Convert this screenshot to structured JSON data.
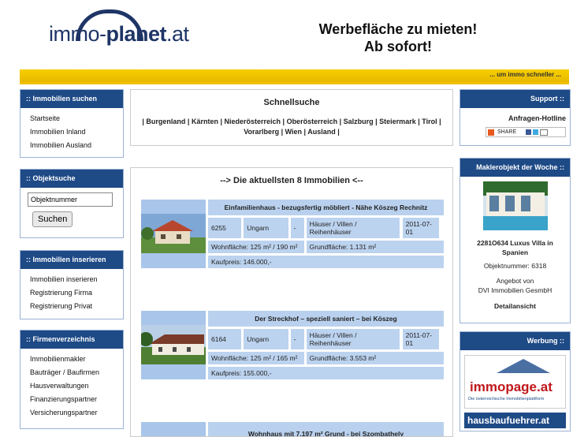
{
  "header": {
    "logo_prefix": "immo-",
    "logo_main": "planet",
    "logo_suffix": ".at",
    "ad_line1": "Werbefläche zu mieten!",
    "ad_line2": "Ab sofort!",
    "slogan": "... um immo schneller ..."
  },
  "left": {
    "search": {
      "head": ":: Immobilien suchen",
      "items": [
        "Startseite",
        "Immobilien Inland",
        "Immobilien Ausland"
      ]
    },
    "objekt": {
      "head": ":: Objektsuche",
      "placeholder": "Objektnummer",
      "button": "Suchen"
    },
    "inserieren": {
      "head": ":: Immobilien inserieren",
      "items": [
        "Immobilien inserieren",
        "Registrierung Firma",
        "Registrierung Privat"
      ]
    },
    "firmen": {
      "head": ":: Firmenverzeichnis",
      "items": [
        "Immobilienmakler",
        "Bauträger / Baufirmen",
        "Hausverwaltungen",
        "Finanzierungspartner",
        "Versicherungspartner"
      ]
    }
  },
  "center": {
    "schnell_title": "Schnellsuche",
    "regions": [
      "Burgenland",
      "Kärnten",
      "Niederösterreich",
      "Oberösterreich",
      "Salzburg",
      "Steiermark",
      "Tirol",
      "Vorarlberg",
      "Wien",
      "Ausland"
    ],
    "latest_title": "--> Die aktuellsten 8 Immobilien <--",
    "listings": [
      {
        "title": "Einfamilienhaus - bezugsfertig möbliert - Nähe Köszeg Rechnitz",
        "plz": "6255",
        "country": "Ungarn",
        "dash": "-",
        "type": "Häuser / Villen / Reihenhäuser",
        "date": "2011-07-01",
        "wohn": "Wohnfläche: 125 m² / 190 m²",
        "grund": "Grundfläche: 1.131 m²",
        "preis": "Kaufpreis: 146.000,-"
      },
      {
        "title": "Der Streckhof – speziell saniert – bei Köszeg",
        "plz": "6164",
        "country": "Ungarn",
        "dash": "-",
        "type": "Häuser / Villen / Reihenhäuser",
        "date": "2011-07-01",
        "wohn": "Wohnfläche: 125 m² / 165 m²",
        "grund": "Grundfläche: 3.553 m²",
        "preis": "Kaufpreis: 155.000,-"
      },
      {
        "title": "Wohnhaus mit 7.197 m² Grund - bei Szombathely"
      }
    ]
  },
  "right": {
    "support": {
      "head": "Support ::",
      "hotline": "Anfragen-Hotline",
      "share": "SHARE"
    },
    "makler": {
      "head": "Maklerobjekt der Woche ::",
      "title": "2281O634 Luxus Villa in Spanien",
      "objnr": "Objektnummer: 6318",
      "angebot": "Angebot von",
      "firma": "DVI Immobilien GesmbH",
      "detail": "Detailansicht"
    },
    "werbung": {
      "head": "Werbung ::",
      "brand1": "immopage.at",
      "brand1_sub": "Die österreichische Immobilienplattform",
      "brand2": "hausbaufuehrer.at"
    }
  }
}
